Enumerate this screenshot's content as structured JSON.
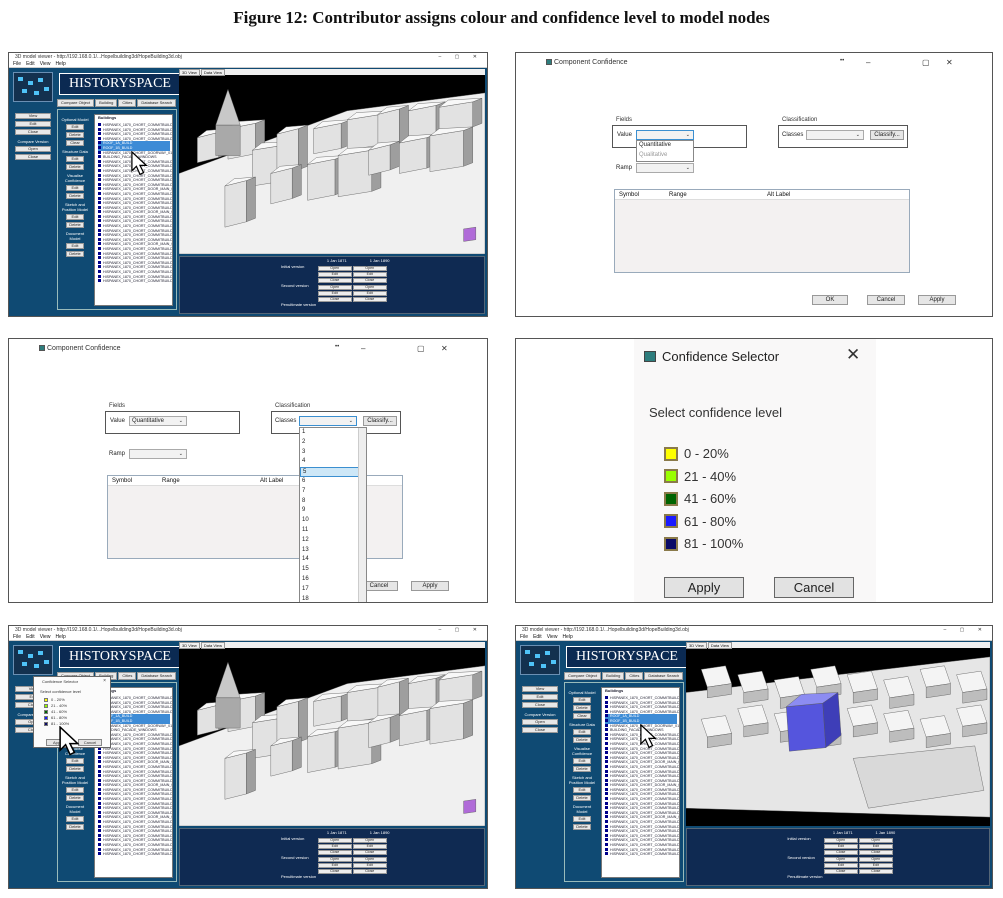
{
  "figure_title": "Figure 12: Contributor assigns colour and confidence level to model nodes",
  "viewer": {
    "window_title": "3D model viewer - http://192.168.0.1/...Hopelbuilding3d/HopeBuilding3d.obj",
    "menu": [
      "File",
      "Edit",
      "View",
      "Help"
    ],
    "brand": "HISTORYSPACE",
    "sidebar_buttons": [
      "View",
      "Edit",
      "Close"
    ],
    "sidebar_section": "Compare Version",
    "sidebar_buttons2": [
      "Open",
      "Close"
    ],
    "tabs": [
      "Compare Object",
      "Building",
      "Cities",
      "Database Search"
    ],
    "tree_header": "Buildings",
    "left_labels": [
      "Optional Model",
      "Structure Data",
      "Visualise Confidence",
      "Sketch and Position Model",
      "Document Model"
    ],
    "left_btn_labels": [
      "Edit",
      "Delete",
      "Clear"
    ],
    "tree_rows": [
      "HISPANEX_1870_CHORT_COMMITBUILDING_M",
      "HISPANEX_1870_CHORT_COMMITBUILDING_N",
      "HISPANEX_1870_CHORT_COMMITBUILDING_O",
      "HISPANEX_1870_CHORT_COMMITBUILDING_P",
      "ROOF_1A_BUILD",
      "ROOF_1B_BUILD",
      "HISPANEX_1870_CHORT_DOORWAY_01",
      "BUILDING_FACADE_WINDOWS",
      "HISPANEX_1870_CHORT_COMMITBUILDING_Q",
      "HISPANEX_1870_CHORT_COMMITBUILDING_R",
      "HISPANEX_1870_CHORT_COMMITBUILDING_S",
      "HISPANEX_1870_CHORT_COMMITBUILDING_T",
      "HISPANEX_1870_CHORT_COMMITBUILDING_U",
      "HISPANEX_1870_CHORT_COMMITBUILDING_V",
      "HISPANEX_1870_CHORT_DOOR_MAIN_01",
      "HISPANEX_1870_CHORT_COMMITBUILDING_W",
      "HISPANEX_1870_CHORT_COMMITBUILDING_X",
      "HISPANEX_1870_CHORT_COMMITBUILDING_Y",
      "HISPANEX_1870_CHORT_COMMITBUILDING_Z",
      "HISPANEX_1870_CHORT_DOOR_MAIN_02",
      "HISPANEX_1870_CHORT_COMMITBUILDING_AA",
      "HISPANEX_1870_CHORT_COMMITBUILDING_AB",
      "HISPANEX_1870_CHORT_COMMITBUILDING_AC",
      "HISPANEX_1870_CHORT_COMMITBUILDING_AD",
      "HISPANEX_1870_CHORT_COMMITBUILDING_AE",
      "HISPANEX_1870_CHORT_COMMITBUILDING_AF",
      "HISPANEX_1870_CHORT_DOOR_MAIN_03",
      "HISPANEX_1870_CHORT_COMMITBUILDING_AG",
      "HISPANEX_1870_CHORT_COMMITBUILDING_AH",
      "HISPANEX_1870_CHORT_COMMITBUILDING_AI",
      "HISPANEX_1870_CHORT_COMMITBUILDING_AJ",
      "HISPANEX_1870_CHORT_COMMITBUILDING_AK",
      "HISPANEX_1870_CHORT_COMMITBUILDING_AL",
      "HISPANEX_1870_CHORT_COMMITBUILDING_AM",
      "HISPANEX_1870_CHORT_COMMITBUILDING_AN"
    ],
    "view_tabs": [
      "3D View",
      "Data View"
    ],
    "date_from": "1 Jan 1871",
    "date_to": "1 Jan 1890",
    "version_labels": [
      "Initial version",
      "Second version",
      "Penultimate version"
    ],
    "version_buttons": [
      "Open",
      "Edit",
      "Close"
    ]
  },
  "component_dialog": {
    "title": "Component Confidence",
    "fields_label": "Fields",
    "value_label": "Value",
    "value_selected": "Quantitative",
    "value_options": [
      "Quantitative",
      "Qualitative"
    ],
    "classification_label": "Classification",
    "classes_label": "Classes",
    "classify_button": "Classify...",
    "ramp_label": "Ramp",
    "table_headers": [
      "Symbol",
      "Range",
      "Alt Label"
    ],
    "ok_button": "OK",
    "cancel_button": "Cancel",
    "apply_button": "Apply",
    "class_options": [
      "1",
      "2",
      "3",
      "4",
      "5",
      "6",
      "7",
      "8",
      "9",
      "10",
      "11",
      "12",
      "13",
      "14",
      "15",
      "16",
      "17",
      "18"
    ],
    "class_highlight": "5"
  },
  "confidence_selector": {
    "title": "Confidence Selector",
    "prompt": "Select confidence level",
    "levels": [
      {
        "label": "0 - 20%",
        "color": "#ffff00"
      },
      {
        "label": "21 - 40%",
        "color": "#99ff00"
      },
      {
        "label": "41 - 60%",
        "color": "#006400"
      },
      {
        "label": "61 - 80%",
        "color": "#1a1aff"
      },
      {
        "label": "81 - 100%",
        "color": "#0a0a66"
      }
    ],
    "apply_button": "Apply",
    "cancel_button": "Cancel"
  },
  "mini_selector": {
    "title": "Confidence Selector",
    "prompt": "Select confidence level",
    "apply": "Apply",
    "cancel": "Cancel"
  }
}
